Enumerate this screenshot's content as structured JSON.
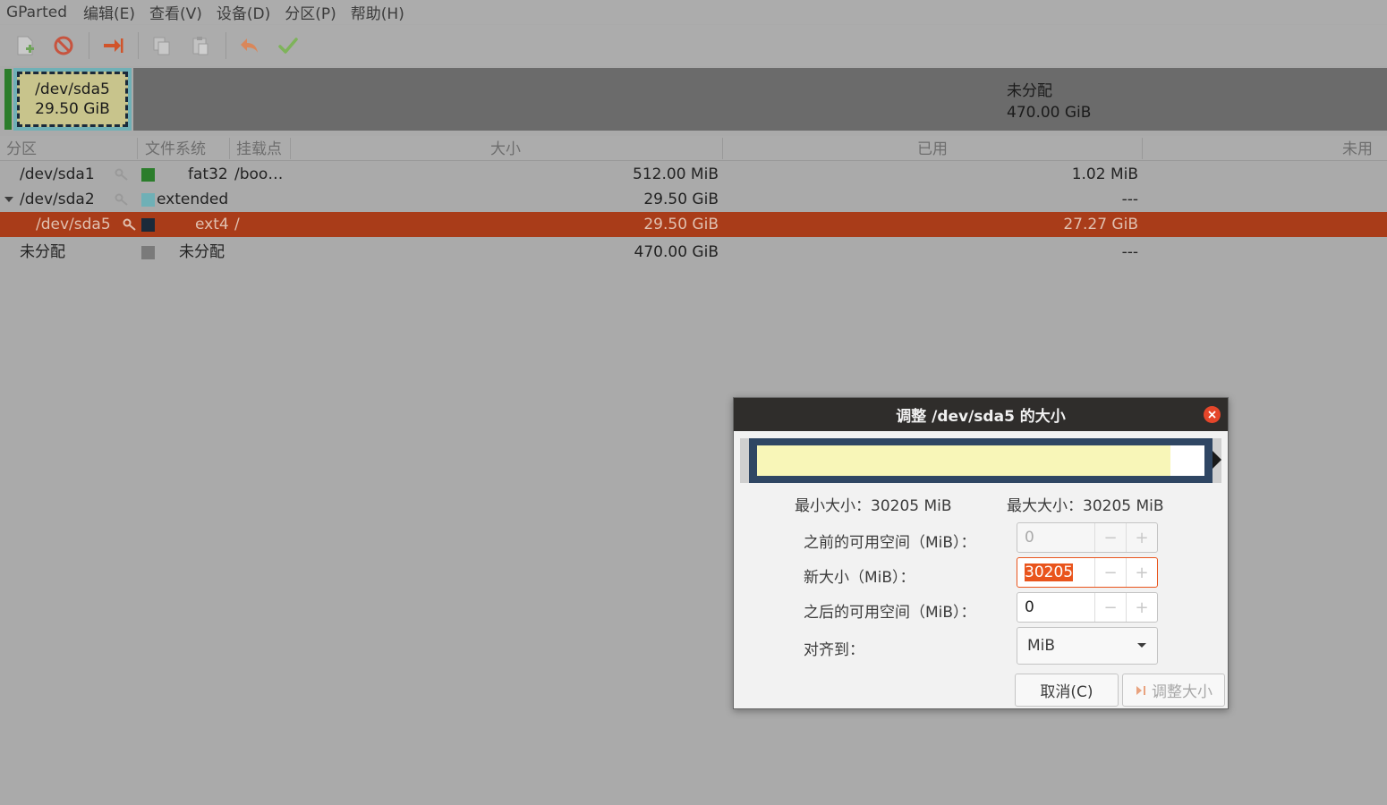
{
  "menubar": {
    "items": [
      "GParted",
      "编辑(E)",
      "查看(V)",
      "设备(D)",
      "分区(P)",
      "帮助(H)"
    ]
  },
  "toolbar": {
    "icons": [
      "new-partition-icon",
      "delete-icon",
      "resize-move-icon",
      "copy-icon",
      "paste-icon",
      "undo-icon",
      "apply-icon"
    ]
  },
  "diskmap": {
    "sda5": {
      "name": "/dev/sda5",
      "size": "29.50 GiB"
    },
    "unallocated": {
      "name": "未分配",
      "size": "470.00 GiB"
    }
  },
  "table": {
    "headers": {
      "partition": "分区",
      "filesystem": "文件系统",
      "mountpoint": "挂载点",
      "size": "大小",
      "used": "已用",
      "unused": "未用"
    },
    "rows": [
      {
        "partition": "/dev/sda1",
        "filesystem": "fat32",
        "mountpoint": "/boo…",
        "size": "512.00 MiB",
        "used": "1.02 MiB",
        "color": "#2b7d2b"
      },
      {
        "partition": "/dev/sda2",
        "filesystem": "extended",
        "mountpoint": "",
        "size": "29.50 GiB",
        "used": "---",
        "color": "#6fb0b6"
      },
      {
        "partition": "/dev/sda5",
        "filesystem": "ext4",
        "mountpoint": "/",
        "size": "29.50 GiB",
        "used": "27.27 GiB",
        "color": "#1b2a3a"
      },
      {
        "partition": "未分配",
        "filesystem": "未分配",
        "mountpoint": "",
        "size": "470.00 GiB",
        "used": "---",
        "color": "#7a7a7a"
      }
    ]
  },
  "dialog": {
    "title": "调整 /dev/sda5 的大小",
    "min_size": "最小大小：30205 MiB",
    "max_size": "最大大小：30205 MiB",
    "free_before_label": "之前的可用空间（MiB）：",
    "free_before_value": "0",
    "new_size_label": "新大小（MiB）：",
    "new_size_value": "30205",
    "free_after_label": "之后的可用空间（MiB）：",
    "free_after_value": "0",
    "align_label": "对齐到：",
    "align_value": "MiB",
    "cancel_label": "取消(C)",
    "resize_label": "调整大小",
    "spin_minus": "−",
    "spin_plus": "+"
  },
  "colors": {
    "selected_row": "#a93c19",
    "fat32": "#2b7d2b",
    "extended": "#6fb0b6",
    "ext4": "#1b2a3a",
    "unallocated": "#7a7a7a"
  }
}
